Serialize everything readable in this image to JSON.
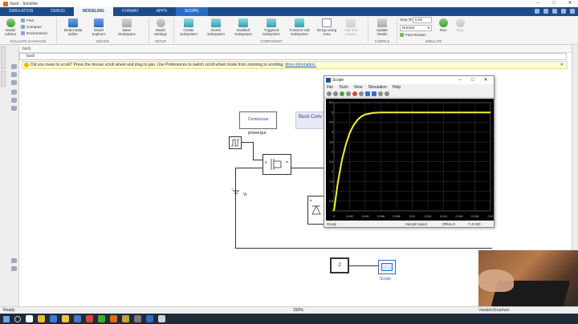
{
  "window": {
    "title": "buck - Simulink"
  },
  "tabs": [
    "SIMULATION",
    "DEBUG",
    "MODELING",
    "FORMAT",
    "APPS",
    "SCOPE"
  ],
  "ribbon": {
    "model_advisor": "Model\nAdvisor",
    "find": "Find",
    "compare": "Compare",
    "environment": "Environment",
    "group1": "EVALUATE & MANAGE",
    "model_data_editor": "Model Data\nEditor",
    "model_explorer": "Model\nExplorer",
    "base_workspace": "Base\nWorkspace",
    "group2": "DESIGN",
    "model_settings": "Model\nSettings",
    "group3": "SETUP",
    "create_subsystem": "Create\nSubsystem",
    "atomic_subsystem": "Atomic\nSubsystem",
    "enabled_subsystem": "Enabled\nSubsystem",
    "triggered_subsystem": "Triggered\nSubsystem",
    "function_call_subsystem": "Function-call\nSubsystem",
    "group_using_area": "Group Using\nArea",
    "add_bus_creator": "Add Bus\nCreator",
    "group4": "COMPONENT",
    "update_model": "Update\nModel",
    "group5": "COMPILE",
    "stop_time_label": "Stop Time",
    "stop_time_value": "0.02",
    "mode_value": "Normal",
    "fast_restart": "Fast Restart",
    "run": "Run",
    "stop": "Stop",
    "group6": "SIMULATE"
  },
  "address": {
    "model": "buck",
    "path": "buck"
  },
  "infobar": {
    "message": "Did you mean to scroll? Press the mouse scroll wheel and drag to pan. Use Preferences to switch scroll wheel mode from zooming to scrolling.",
    "link": "More information."
  },
  "diagram": {
    "powergui_top": "Continuous",
    "powergui_label": "powergui",
    "buck_annotation": "Buck Conv",
    "vdc_label": "Vi",
    "constant_value": "2",
    "scope_label": "Scope"
  },
  "scope": {
    "title": "Scope",
    "menu": [
      "File",
      "Tools",
      "View",
      "Simulation",
      "Help"
    ],
    "status_left": "Ready",
    "status_mid": "Sample based",
    "status_offset": "Offset=0",
    "status_time": "T=0.020",
    "trace_color": "#f2f230",
    "y_ticks": [
      "5.5",
      "5",
      "4.5",
      "4",
      "3.5",
      "3",
      "2.5",
      "2",
      "1.5",
      "1",
      "0.5",
      "0"
    ],
    "x_ticks": [
      "0",
      "0.002",
      "0.004",
      "0.006",
      "0.008",
      "0.01",
      "0.012",
      "0.014",
      "0.016",
      "0.018",
      "0.02"
    ]
  },
  "chart_data": {
    "type": "line",
    "title": "",
    "xlabel": "",
    "ylabel": "",
    "xlim": [
      0,
      0.02
    ],
    "ylim": [
      0,
      5.5
    ],
    "grid": true,
    "series": [
      {
        "x": [
          0,
          0.0005,
          0.001,
          0.0015,
          0.002,
          0.0025,
          0.003,
          0.0035,
          0.004,
          0.005,
          0.006,
          0.007,
          0.008,
          0.01,
          0.012,
          0.014,
          0.016,
          0.018,
          0.02
        ],
        "values": [
          0,
          1.45,
          2.55,
          3.35,
          3.95,
          4.35,
          4.62,
          4.8,
          4.9,
          4.98,
          5.0,
          5.0,
          5.0,
          5.0,
          5.0,
          5.0,
          5.0,
          5.0,
          5.0
        ]
      }
    ]
  },
  "statusbar": {
    "ready": "Ready",
    "zoom": "150%",
    "solver": "VariableStepAuto"
  },
  "tray": {
    "time": "",
    "date": ""
  }
}
